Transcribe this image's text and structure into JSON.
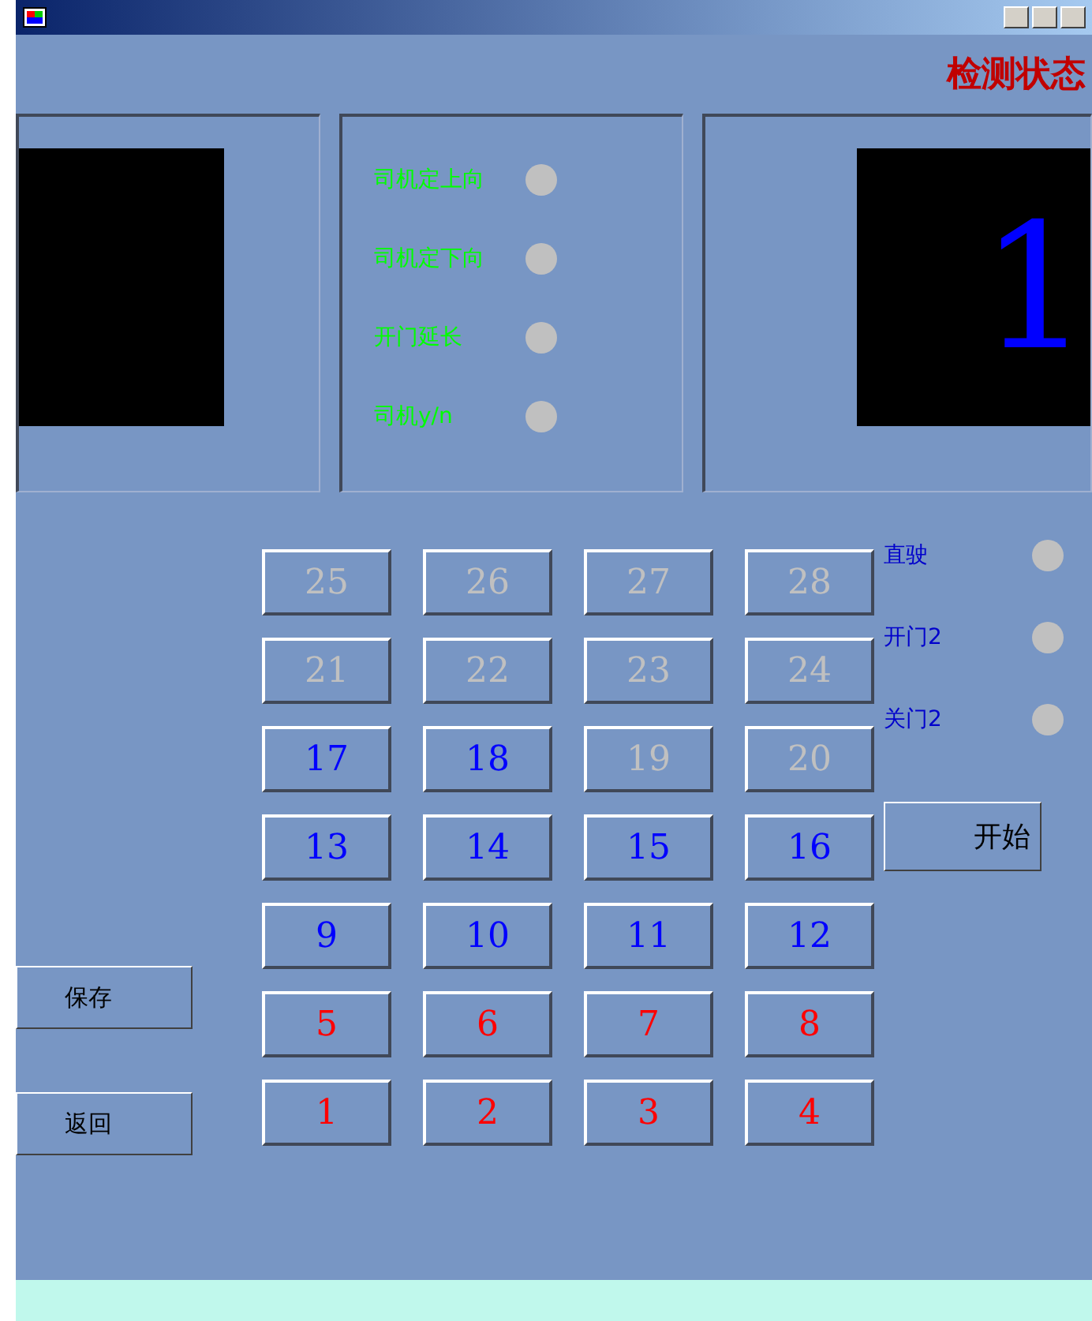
{
  "header": {
    "title": "检测状态"
  },
  "right_display": {
    "reading": "1"
  },
  "indicators": [
    {
      "label": "司机定上向",
      "on": false
    },
    {
      "label": "司机定下向",
      "on": false
    },
    {
      "label": "开门延长",
      "on": false
    },
    {
      "label": "司机y/n",
      "on": false
    }
  ],
  "floor_buttons": [
    {
      "label": "25",
      "color": "#c0c0c0"
    },
    {
      "label": "26",
      "color": "#c0c0c0"
    },
    {
      "label": "27",
      "color": "#c0c0c0"
    },
    {
      "label": "28",
      "color": "#c0c0c0"
    },
    {
      "label": "21",
      "color": "#c0c0c0"
    },
    {
      "label": "22",
      "color": "#c0c0c0"
    },
    {
      "label": "23",
      "color": "#c0c0c0"
    },
    {
      "label": "24",
      "color": "#c0c0c0"
    },
    {
      "label": "17",
      "color": "#0000ff"
    },
    {
      "label": "18",
      "color": "#0000ff"
    },
    {
      "label": "19",
      "color": "#c0c0c0"
    },
    {
      "label": "20",
      "color": "#c0c0c0"
    },
    {
      "label": "13",
      "color": "#0000ff"
    },
    {
      "label": "14",
      "color": "#0000ff"
    },
    {
      "label": "15",
      "color": "#0000ff"
    },
    {
      "label": "16",
      "color": "#0000ff"
    },
    {
      "label": "9",
      "color": "#0000ff"
    },
    {
      "label": "10",
      "color": "#0000ff"
    },
    {
      "label": "11",
      "color": "#0000ff"
    },
    {
      "label": "12",
      "color": "#0000ff"
    },
    {
      "label": "5",
      "color": "#ff0000"
    },
    {
      "label": "6",
      "color": "#ff0000"
    },
    {
      "label": "7",
      "color": "#ff0000"
    },
    {
      "label": "8",
      "color": "#ff0000"
    },
    {
      "label": "1",
      "color": "#ff0000"
    },
    {
      "label": "2",
      "color": "#ff0000"
    },
    {
      "label": "3",
      "color": "#ff0000"
    },
    {
      "label": "4",
      "color": "#ff0000"
    }
  ],
  "left_buttons": [
    "保存",
    "返回"
  ],
  "status_lights": [
    {
      "label": "直驶",
      "on": false
    },
    {
      "label": "开门2",
      "on": false
    },
    {
      "label": "关门2",
      "on": false
    }
  ],
  "start_button": "开始"
}
